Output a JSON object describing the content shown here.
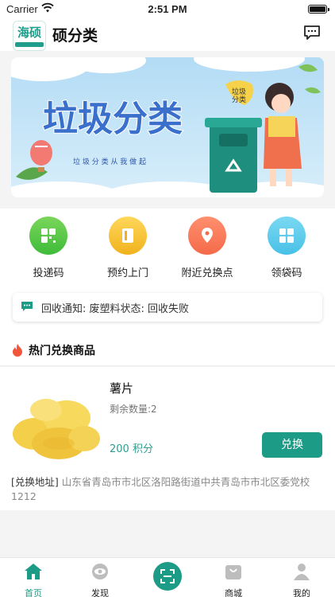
{
  "status_bar": {
    "carrier": "Carrier",
    "time": "2:51 PM"
  },
  "header": {
    "logo_text": "海硕",
    "title": "硕分类"
  },
  "banner": {
    "headline": "垃圾分类",
    "subline": "垃 圾 分 类 从 我 做 起",
    "tag": "垃圾\n分类",
    "tag_line1": "垃圾",
    "tag_line2": "分类"
  },
  "shortcuts": [
    {
      "label": "投递码",
      "color": "#3fbb3a",
      "icon": "qrcode-icon"
    },
    {
      "label": "预约上门",
      "color": "#f0b21e",
      "icon": "door-icon"
    },
    {
      "label": "附近兑换点",
      "color": "#f46a4a",
      "icon": "location-pin-icon"
    },
    {
      "label": "领袋码",
      "color": "#49c0e6",
      "icon": "grid-icon"
    }
  ],
  "notice": {
    "text": "回收通知: 废塑料状态: 回收失败"
  },
  "hot_section": {
    "title": "热门兑换商品"
  },
  "product": {
    "name": "薯片",
    "stock": "剩余数量:2",
    "points": "200 积分",
    "exchange_label": "兑换",
    "address_label": "[兑换地址]",
    "address": "山东省青岛市市北区洛阳路街道中共青岛市市北区委党校1212"
  },
  "tabbar": {
    "items": [
      {
        "label": "首页",
        "active": true
      },
      {
        "label": "发现",
        "active": false
      },
      {
        "label": "商城",
        "active": false
      },
      {
        "label": "我的",
        "active": false
      }
    ]
  },
  "colors": {
    "accent": "#1c9c86",
    "background": "#f4f4f5"
  }
}
